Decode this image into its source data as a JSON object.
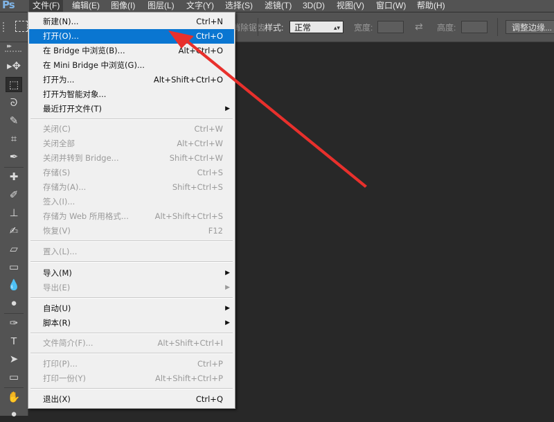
{
  "app": {
    "logo": "Ps"
  },
  "menubar": {
    "items": [
      {
        "label": "文件(F)"
      },
      {
        "label": "编辑(E)"
      },
      {
        "label": "图像(I)"
      },
      {
        "label": "图层(L)"
      },
      {
        "label": "文字(Y)"
      },
      {
        "label": "选择(S)"
      },
      {
        "label": "滤镜(T)"
      },
      {
        "label": "3D(D)"
      },
      {
        "label": "视图(V)"
      },
      {
        "label": "窗口(W)"
      },
      {
        "label": "帮助(H)"
      }
    ]
  },
  "options": {
    "anti_alias": "消除锯齿",
    "style_label": "样式:",
    "style_value": "正常",
    "width_label": "宽度:",
    "height_label": "高度:",
    "refine_edge": "调整边缘..."
  },
  "toolbox": {
    "collapse": "▸▸",
    "tools": [
      {
        "icon": "move-tool-icon",
        "glyph": "▸✥"
      },
      {
        "icon": "rectangular-marquee-icon",
        "glyph": "⬚"
      },
      {
        "icon": "lasso-icon",
        "glyph": "ᘐ"
      },
      {
        "icon": "quick-selection-icon",
        "glyph": "✎"
      },
      {
        "icon": "crop-icon",
        "glyph": "⌗"
      },
      {
        "icon": "eyedropper-icon",
        "glyph": "✒"
      },
      {
        "icon": "healing-brush-icon",
        "glyph": "✚"
      },
      {
        "icon": "brush-icon",
        "glyph": "✐"
      },
      {
        "icon": "clone-stamp-icon",
        "glyph": "⊥"
      },
      {
        "icon": "history-brush-icon",
        "glyph": "✍"
      },
      {
        "icon": "eraser-icon",
        "glyph": "▱"
      },
      {
        "icon": "gradient-icon",
        "glyph": "▭"
      },
      {
        "icon": "blur-icon",
        "glyph": "💧"
      },
      {
        "icon": "dodge-icon",
        "glyph": "●"
      },
      {
        "icon": "pen-icon",
        "glyph": "✑"
      },
      {
        "icon": "type-icon",
        "glyph": "T"
      },
      {
        "icon": "path-selection-icon",
        "glyph": "➤"
      },
      {
        "icon": "rectangle-shape-icon",
        "glyph": "▭"
      },
      {
        "icon": "hand-icon",
        "glyph": "✋"
      },
      {
        "icon": "zoom-icon",
        "glyph": "●"
      }
    ]
  },
  "file_menu": {
    "items": [
      {
        "label": "新建(N)...",
        "shortcut": "Ctrl+N",
        "state": "enabled"
      },
      {
        "label": "打开(O)...",
        "shortcut": "Ctrl+O",
        "state": "highlighted"
      },
      {
        "label": "在 Bridge 中浏览(B)...",
        "shortcut": "Alt+Ctrl+O",
        "state": "enabled"
      },
      {
        "label": "在 Mini Bridge 中浏览(G)...",
        "shortcut": "",
        "state": "enabled"
      },
      {
        "label": "打开为...",
        "shortcut": "Alt+Shift+Ctrl+O",
        "state": "enabled"
      },
      {
        "label": "打开为智能对象...",
        "shortcut": "",
        "state": "enabled"
      },
      {
        "label": "最近打开文件(T)",
        "shortcut": "",
        "state": "enabled",
        "submenu": true
      },
      {
        "label": "关闭(C)",
        "shortcut": "Ctrl+W",
        "state": "disabled"
      },
      {
        "label": "关闭全部",
        "shortcut": "Alt+Ctrl+W",
        "state": "disabled"
      },
      {
        "label": "关闭并转到 Bridge...",
        "shortcut": "Shift+Ctrl+W",
        "state": "disabled"
      },
      {
        "label": "存储(S)",
        "shortcut": "Ctrl+S",
        "state": "disabled"
      },
      {
        "label": "存储为(A)...",
        "shortcut": "Shift+Ctrl+S",
        "state": "disabled"
      },
      {
        "label": "签入(I)...",
        "shortcut": "",
        "state": "disabled"
      },
      {
        "label": "存储为 Web 所用格式...",
        "shortcut": "Alt+Shift+Ctrl+S",
        "state": "disabled"
      },
      {
        "label": "恢复(V)",
        "shortcut": "F12",
        "state": "disabled"
      },
      {
        "label": "置入(L)...",
        "shortcut": "",
        "state": "disabled"
      },
      {
        "label": "导入(M)",
        "shortcut": "",
        "state": "enabled",
        "submenu": true
      },
      {
        "label": "导出(E)",
        "shortcut": "",
        "state": "disabled",
        "submenu": true
      },
      {
        "label": "自动(U)",
        "shortcut": "",
        "state": "enabled",
        "submenu": true
      },
      {
        "label": "脚本(R)",
        "shortcut": "",
        "state": "enabled",
        "submenu": true
      },
      {
        "label": "文件简介(F)...",
        "shortcut": "Alt+Shift+Ctrl+I",
        "state": "disabled"
      },
      {
        "label": "打印(P)...",
        "shortcut": "Ctrl+P",
        "state": "disabled"
      },
      {
        "label": "打印一份(Y)",
        "shortcut": "Alt+Shift+Ctrl+P",
        "state": "disabled"
      },
      {
        "label": "退出(X)",
        "shortcut": "Ctrl+Q",
        "state": "enabled"
      }
    ]
  },
  "colors": {
    "highlight": "#0a76d1",
    "annotation_arrow": "#e8302c"
  }
}
